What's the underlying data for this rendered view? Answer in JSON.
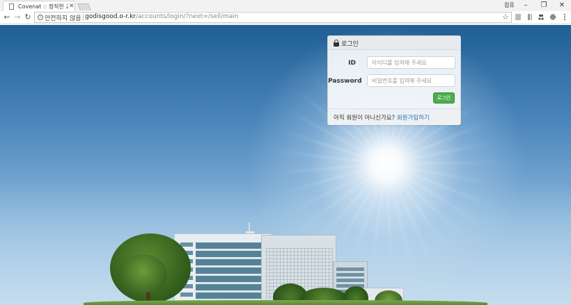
{
  "browser": {
    "tab_title": "Covenat :: 정직한 교육시",
    "profile_name": "컴퓨",
    "security_label": "안전하지 않음",
    "url_host": "godisgood.o-r.kr",
    "url_path": "/accounts/login/?next=/sell/main",
    "icons": {
      "back": "back-arrow-icon",
      "forward": "forward-arrow-icon",
      "reload": "reload-icon",
      "info": "info-icon",
      "star": "bookmark-star-icon",
      "close_tab": "close-icon",
      "minimize": "minimize-icon",
      "maximize": "restore-icon",
      "close_window": "close-icon"
    }
  },
  "login": {
    "title": "로그인",
    "id_label": "ID",
    "id_placeholder": "아이디를 입력해 주세요",
    "password_label": "Password",
    "password_placeholder": "비밀번호를 입력해 주세요",
    "submit_label": "로그인",
    "signup_prompt": "아직 회원이 아니신가요?",
    "signup_link": "회원가입하기"
  },
  "colors": {
    "button": "#4cae4c",
    "link": "#2a6fb5",
    "sky_top": "#1f5f94"
  }
}
